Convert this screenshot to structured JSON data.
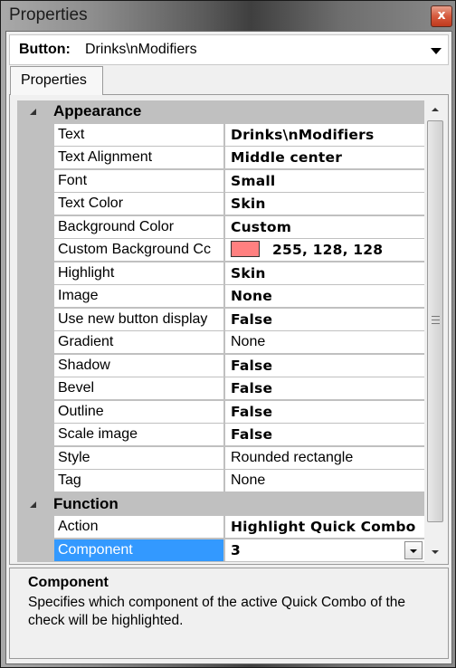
{
  "window": {
    "title": "Properties",
    "close_label": "x"
  },
  "selector": {
    "type_label": "Button:",
    "object_name": "Drinks\\nModifiers"
  },
  "tabs": [
    {
      "label": "Properties",
      "active": true
    }
  ],
  "grid": {
    "categories": [
      {
        "label": "Appearance",
        "expanded": true,
        "properties": [
          {
            "name": "Text",
            "value": "Drinks\\nModifiers",
            "bold": true
          },
          {
            "name": "Text Alignment",
            "value": "Middle center",
            "bold": true
          },
          {
            "name": "Font",
            "value": "Small",
            "bold": true
          },
          {
            "name": "Text Color",
            "value": "Skin",
            "bold": true
          },
          {
            "name": "Background Color",
            "value": "Custom",
            "bold": true
          },
          {
            "name": "Custom Background Color",
            "name_display": "Custom Background Cc",
            "value": "255, 128, 128",
            "bold": true,
            "swatch_color": "#ff8080"
          },
          {
            "name": "Highlight",
            "value": "Skin",
            "bold": true
          },
          {
            "name": "Image",
            "value": "None",
            "bold": true
          },
          {
            "name": "Use new button display",
            "name_display": "Use new button display",
            "value": "False",
            "bold": true
          },
          {
            "name": "Gradient",
            "value": "None",
            "bold": false
          },
          {
            "name": "Shadow",
            "value": "False",
            "bold": true
          },
          {
            "name": "Bevel",
            "value": "False",
            "bold": true
          },
          {
            "name": "Outline",
            "value": "False",
            "bold": true
          },
          {
            "name": "Scale image",
            "value": "False",
            "bold": true
          },
          {
            "name": "Style",
            "value": "Rounded rectangle",
            "bold": false
          },
          {
            "name": "Tag",
            "value": "None",
            "bold": false
          }
        ]
      },
      {
        "label": "Function",
        "expanded": true,
        "properties": [
          {
            "name": "Action",
            "value": "Highlight Quick Combo",
            "bold": true
          },
          {
            "name": "Component",
            "value": "3",
            "bold": true,
            "selected": true,
            "has_dropdown": true
          }
        ]
      }
    ]
  },
  "help": {
    "title": "Component",
    "description": "Specifies which component of the active Quick Combo of the check will be highlighted."
  },
  "colors": {
    "selection": "#3399ff",
    "category_bg": "#c0c0c0",
    "close_button": "#d65a3e"
  }
}
